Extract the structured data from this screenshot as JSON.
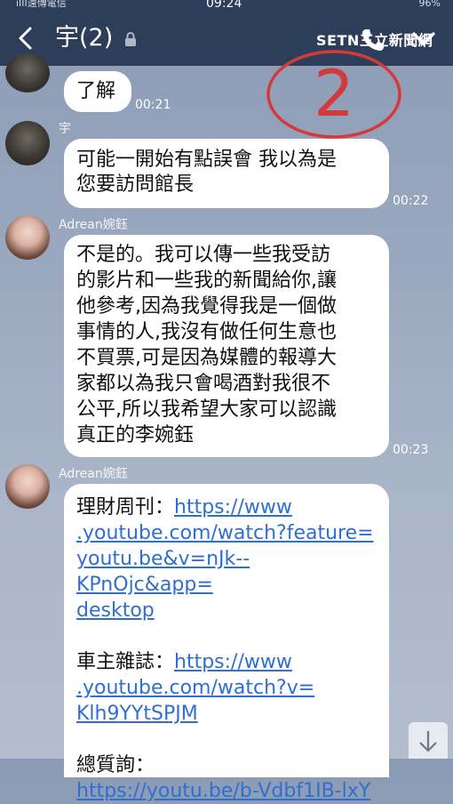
{
  "status": {
    "carrier": "iIII遠傳電信",
    "time": "09:24",
    "battery": "96%"
  },
  "header": {
    "title": "宇(2)"
  },
  "watermark": "SETN三立新聞網",
  "annotation": "2",
  "messages": [
    {
      "text": "了解",
      "time": "00:21"
    },
    {
      "sender": "宇",
      "text_lines": [
        "可能一開始有點誤會 我以為是",
        "您要訪問館長"
      ],
      "time": "00:22"
    },
    {
      "sender": "Adrean婉鈺",
      "text_lines": [
        "不是的。我可以傳一些我受訪",
        "的影片和一些我的新聞給你,讓",
        "他參考,因為我覺得我是一個做",
        "事情的人,我沒有做任何生意也",
        "不買票,可是因為媒體的報導大",
        "家都以為我只會喝酒對我很不",
        "公平,所以我希望大家可以認識",
        "真正的李婉鈺"
      ],
      "time": "00:23"
    },
    {
      "sender": "Adrean婉鈺",
      "block1": {
        "label": "理財周刊：",
        "link_lines": [
          "https://www",
          ".youtube.com/watch?feature=",
          "youtu.be&v=nJk--KPnOjc&app=",
          "desktop"
        ]
      },
      "block2": {
        "label": "車主雜誌：",
        "link_lines": [
          "https://www",
          ".youtube.com/watch?v=",
          "Klh9YYtSPJM"
        ]
      },
      "block3": {
        "label": "總質詢：",
        "link_lines": [
          "https://youtu.be/b-Vdbf1IB-lxY"
        ]
      }
    }
  ]
}
